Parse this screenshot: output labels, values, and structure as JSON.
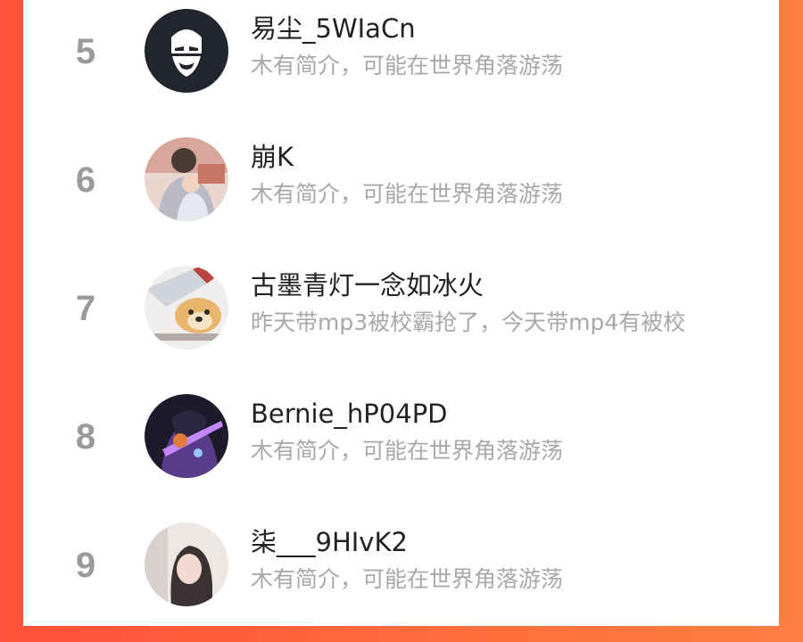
{
  "ranking": {
    "items": [
      {
        "rank": "5",
        "name": "易尘_5WIaCn",
        "bio": "木有简介，可能在世界角落游荡",
        "avatar_icon": "masked-face-avatar"
      },
      {
        "rank": "6",
        "name": "崩K",
        "bio": "木有简介，可能在世界角落游荡",
        "avatar_icon": "photo-avatar"
      },
      {
        "rank": "7",
        "name": "古墨青灯一念如冰火",
        "bio": "昨天带mp3被校霸抢了，今天带mp4有被校",
        "avatar_icon": "dog-meme-avatar"
      },
      {
        "rank": "8",
        "name": "Bernie_hP04PD",
        "bio": "木有简介，可能在世界角落游荡",
        "avatar_icon": "game-character-avatar"
      },
      {
        "rank": "9",
        "name": "柒___9HIvK2",
        "bio": "木有简介，可能在世界角落游荡",
        "avatar_icon": "photo-avatar"
      }
    ]
  },
  "colors": {
    "background_left": "#ff4f3a",
    "background_right": "#ff7f3f",
    "rank_gray": "#9a9a9a",
    "name_text": "#222222",
    "bio_text": "#a8a8a8"
  }
}
